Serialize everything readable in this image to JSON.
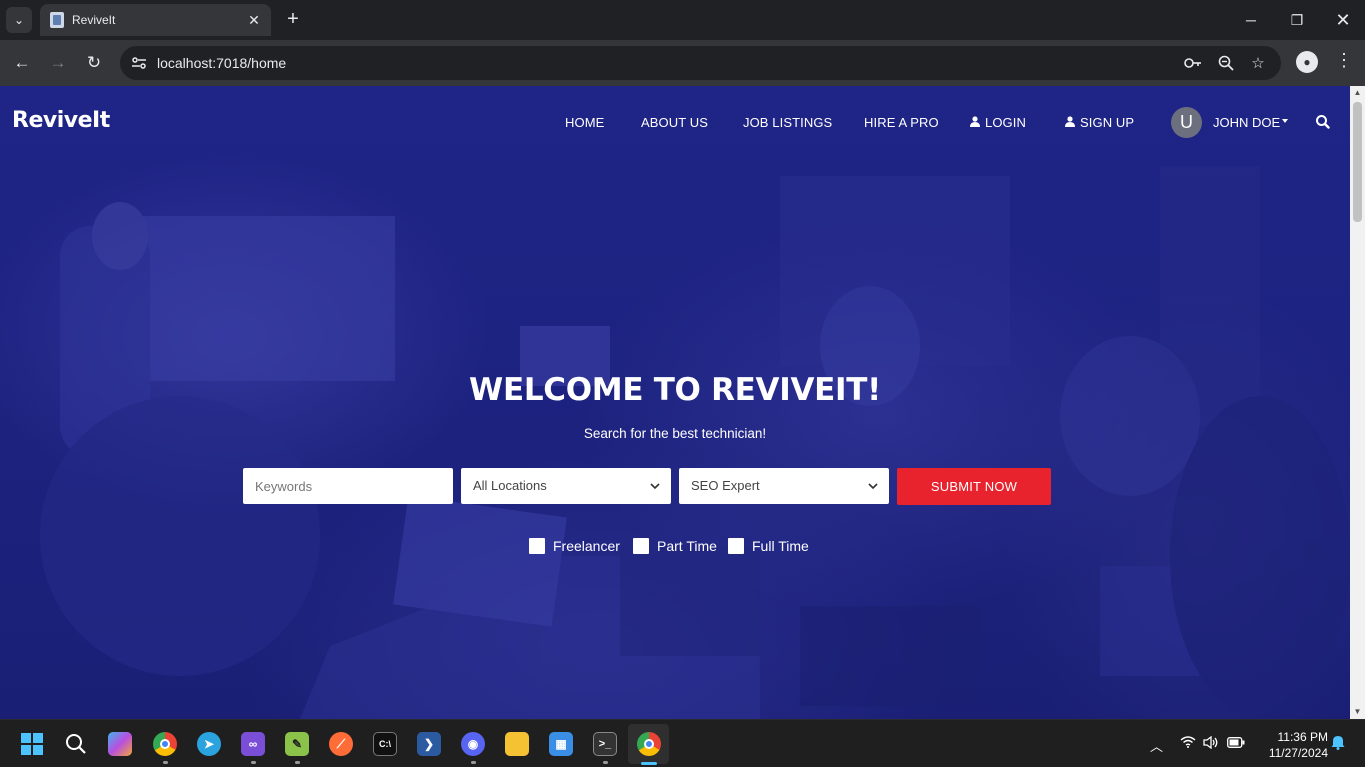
{
  "browser": {
    "tab_title": "ReviveIt",
    "url": "localhost:7018/home",
    "new_tab_symbol": "+",
    "close_symbol": "✕"
  },
  "site": {
    "brand": "ReviveIt",
    "nav": {
      "home": "HOME",
      "about": "ABOUT US",
      "jobs": "JOB LISTINGS",
      "hire": "HIRE A PRO",
      "login": "LOGIN",
      "signup": "SIGN UP"
    },
    "user": {
      "avatar_initial": "U",
      "name": "JOHN DOE"
    }
  },
  "hero": {
    "title": "WELCOME TO REVIVEIT!",
    "subtitle": "Search for the best technician!",
    "keywords_placeholder": "Keywords",
    "location_value": "All Locations",
    "category_value": "SEO Expert",
    "submit_label": "SUBMIT NOW",
    "job_types": [
      "Freelancer",
      "Part Time",
      "Full Time"
    ]
  },
  "taskbar": {
    "apps": [
      "start",
      "search",
      "copilot",
      "chrome",
      "telegram",
      "visual-studio",
      "notepad-plus",
      "postman",
      "terminal",
      "powershell",
      "discord",
      "file-explorer",
      "microsoft-store",
      "command-prompt",
      "chrome-active"
    ],
    "time": "11:36 PM",
    "date": "11/27/2024"
  },
  "colors": {
    "hero_overlay": "#1f2586",
    "submit": "#e8232d",
    "chrome_dark": "#202124",
    "chrome_toolbar": "#35363a"
  }
}
